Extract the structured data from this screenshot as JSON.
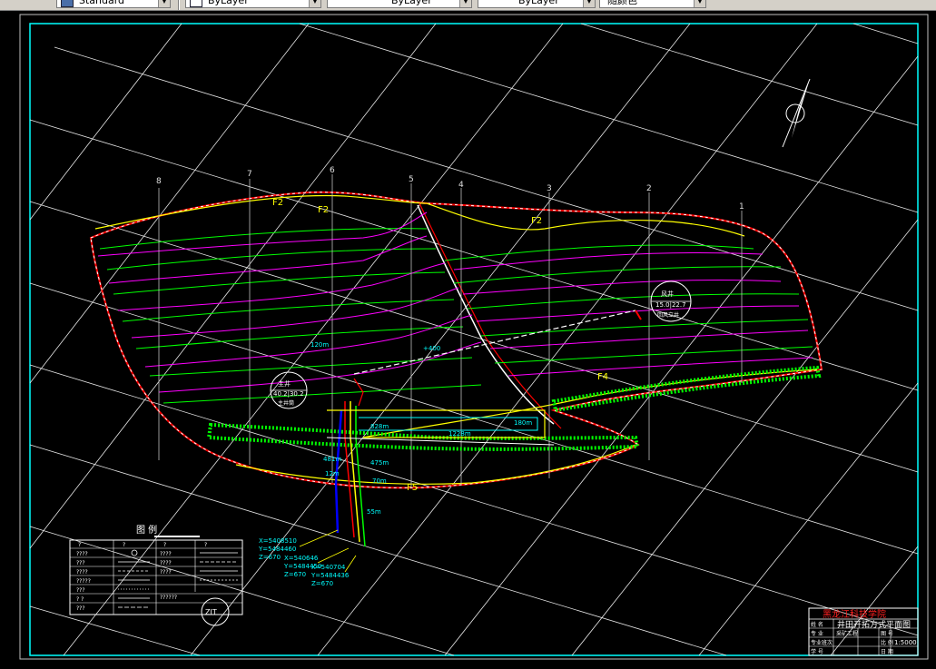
{
  "toolbar": {
    "text_style": "Standard",
    "layer": "ByLayer",
    "linetype": "ByLayer",
    "lineweight": "ByLayer",
    "color": "随颜色"
  },
  "drawing": {
    "exploration_lines": [
      "8",
      "7",
      "6",
      "5",
      "4",
      "3",
      "2",
      "1"
    ],
    "faults": [
      "F2",
      "F2",
      "F4",
      "F5"
    ],
    "north_arrow": "north-arrow-icon",
    "circle_labels": [
      {
        "top": "主井",
        "mid": "40.2|30.2",
        "bottom": "主井筒"
      },
      {
        "top": "风井",
        "mid": "15.0|22.7",
        "bottom": "回风立井"
      }
    ],
    "coordinates": {
      "a": [
        "X=5408510",
        "Y=5484460",
        "Z=670"
      ],
      "b": [
        "X=540646",
        "Y=5484450",
        "Z=670"
      ],
      "c": [
        "X=540704",
        "Y=5484436",
        "Z=670"
      ]
    },
    "annotations": [
      "+400",
      "120m",
      "828m",
      "1228m",
      "180m",
      "481m",
      "12m",
      "475m",
      "70m",
      "55m"
    ]
  },
  "legend": {
    "title": "图 例",
    "rows": [
      [
        "?",
        "?",
        "?",
        "?"
      ],
      [
        "????",
        "",
        "????",
        ""
      ],
      [
        "???",
        "",
        "????",
        ""
      ],
      [
        "????",
        "",
        "????",
        ""
      ],
      [
        "?????",
        "",
        "",
        ""
      ],
      [
        "???",
        "",
        "",
        ""
      ],
      [
        "?  ?",
        "",
        "??????",
        ""
      ],
      [
        "???",
        "",
        "",
        ""
      ]
    ],
    "logo": "ZIT"
  },
  "title_block": {
    "school": "黑龙江科技学院",
    "drawing_name": "井田开拓方式平面图",
    "left_labels": [
      "姓 名",
      "专 业",
      "专业班次",
      "学 号"
    ],
    "mid_labels": [
      "采矿工程",
      "采矿",
      "",
      ""
    ],
    "right_labels": [
      "图 号",
      "比 例",
      "日 期"
    ],
    "scale": "1:5000"
  },
  "colors": {
    "border": "#00ffff",
    "grid": "#ffffff",
    "yellow": "#ffff00",
    "green": "#00ff00",
    "magenta": "#ff00ff",
    "red": "#ff0000",
    "cyan": "#00ffff",
    "title_red": "#ff2020"
  }
}
